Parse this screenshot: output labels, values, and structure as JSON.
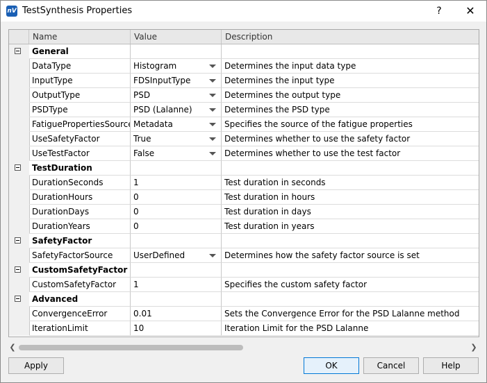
{
  "window": {
    "title": "TestSynthesis Properties",
    "help_label": "?",
    "close_label": "✕",
    "app_icon": "nv-logo-icon",
    "app_icon_text": "nV"
  },
  "columns": {
    "name": "Name",
    "value": "Value",
    "description": "Description"
  },
  "categories": [
    {
      "label": "General",
      "rows": [
        {
          "name": "DataType",
          "value": "Histogram",
          "desc": "Determines the input data type",
          "dropdown": true
        },
        {
          "name": "InputType",
          "value": "FDSInputType",
          "desc": "Determines the input type",
          "dropdown": true
        },
        {
          "name": "OutputType",
          "value": "PSD",
          "desc": "Determines the output type",
          "dropdown": true
        },
        {
          "name": "PSDType",
          "value": "PSD (Lalanne)",
          "desc": "Determines the PSD type",
          "dropdown": true
        },
        {
          "name": "FatiguePropertiesSource",
          "value": "Metadata",
          "desc": "Specifies the source of the fatigue properties",
          "dropdown": true
        },
        {
          "name": "UseSafetyFactor",
          "value": "True",
          "desc": "Determines whether to use the safety factor",
          "dropdown": true
        },
        {
          "name": "UseTestFactor",
          "value": "False",
          "desc": "Determines whether to use the test factor",
          "dropdown": true
        }
      ]
    },
    {
      "label": "TestDuration",
      "rows": [
        {
          "name": "DurationSeconds",
          "value": "1",
          "desc": "Test duration in seconds",
          "dropdown": false
        },
        {
          "name": "DurationHours",
          "value": "0",
          "desc": "Test duration in hours",
          "dropdown": false
        },
        {
          "name": "DurationDays",
          "value": "0",
          "desc": "Test duration in days",
          "dropdown": false
        },
        {
          "name": "DurationYears",
          "value": "0",
          "desc": "Test duration in years",
          "dropdown": false
        }
      ]
    },
    {
      "label": "SafetyFactor",
      "rows": [
        {
          "name": "SafetyFactorSource",
          "value": "UserDefined",
          "desc": "Determines how the safety factor source is set",
          "dropdown": true
        }
      ]
    },
    {
      "label": "CustomSafetyFactor",
      "rows": [
        {
          "name": "CustomSafetyFactor",
          "value": "1",
          "desc": "Specifies the custom safety factor",
          "dropdown": false
        }
      ]
    },
    {
      "label": "Advanced",
      "rows": [
        {
          "name": "ConvergenceError",
          "value": "0.01",
          "desc": "Sets the Convergence Error for the PSD Lalanne method",
          "dropdown": false
        },
        {
          "name": "IterationLimit",
          "value": "10",
          "desc": "Iteration Limit for the PSD Lalanne",
          "dropdown": false
        }
      ]
    }
  ],
  "scrollbar": {
    "left_arrow": "❮",
    "right_arrow": "❯"
  },
  "buttons": {
    "apply": "Apply",
    "ok": "OK",
    "cancel": "Cancel",
    "help": "Help"
  }
}
